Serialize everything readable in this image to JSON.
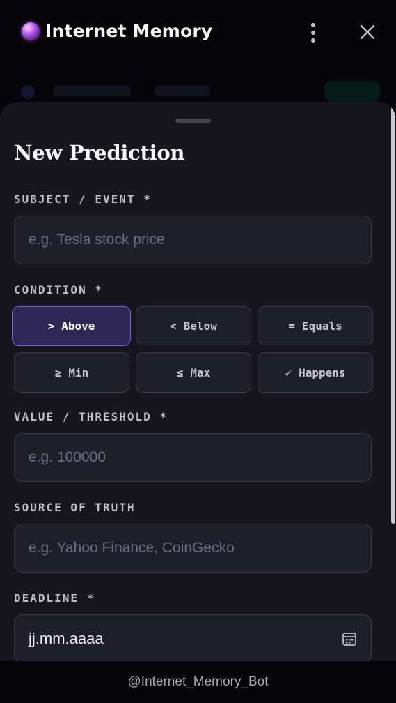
{
  "header": {
    "title": "Internet Memory",
    "icon": "crystal-ball-icon"
  },
  "form": {
    "title": "New Prediction",
    "subject": {
      "label": "SUBJECT / EVENT *",
      "placeholder": "e.g. Tesla stock price",
      "value": ""
    },
    "condition": {
      "label": "CONDITION *",
      "selected": "Above",
      "options": [
        {
          "symbol": ">",
          "label": "Above"
        },
        {
          "symbol": "<",
          "label": "Below"
        },
        {
          "symbol": "=",
          "label": "Equals"
        },
        {
          "symbol": "≥",
          "label": "Min"
        },
        {
          "symbol": "≤",
          "label": "Max"
        },
        {
          "symbol": "✓",
          "label": "Happens"
        }
      ]
    },
    "threshold": {
      "label": "VALUE / THRESHOLD *",
      "placeholder": "e.g. 100000",
      "value": ""
    },
    "source": {
      "label": "SOURCE OF TRUTH",
      "placeholder": "e.g. Yahoo Finance, CoinGecko",
      "value": ""
    },
    "deadline": {
      "label": "DEADLINE *",
      "value": "jj.mm.aaaa"
    }
  },
  "footer": {
    "bot_handle": "@Internet_Memory_Bot"
  },
  "colors": {
    "background": "#050509",
    "sheet": "#17161f",
    "field": "#1f1e2b",
    "border": "#3a3948",
    "accent": "#7a62d8",
    "accent_bg": "#2f2856"
  }
}
